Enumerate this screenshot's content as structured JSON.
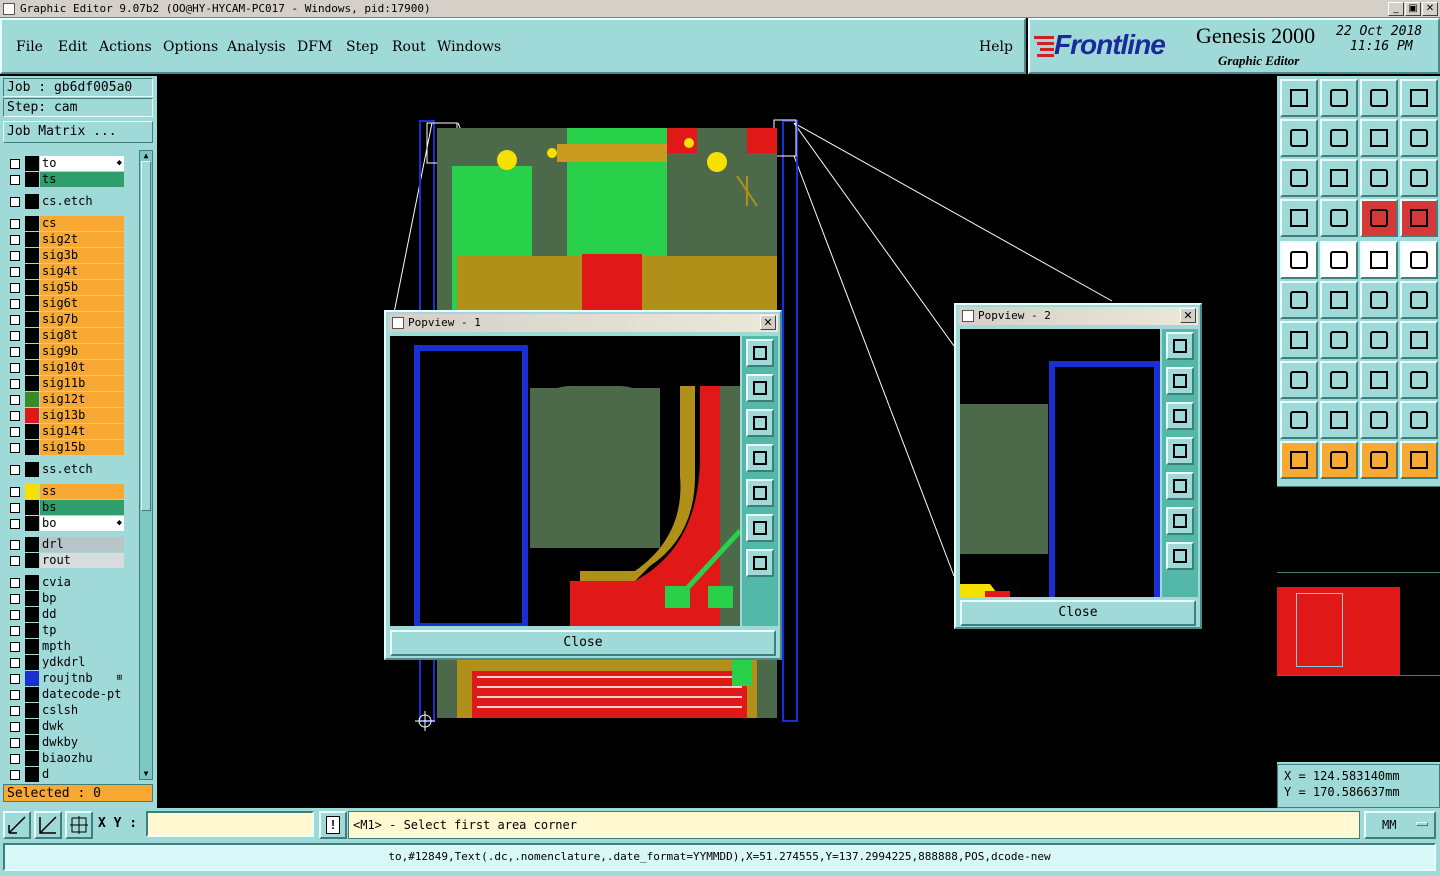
{
  "window": {
    "title": "Graphic Editor 9.07b2 (OO@HY-HYCAM-PC017 - Windows, pid:17900)",
    "min": "_",
    "max": "▣",
    "close": "✕"
  },
  "menu": {
    "items": [
      "File",
      "Edit",
      "Actions",
      "Options",
      "Analysis",
      "DFM",
      "Step",
      "Rout",
      "Windows"
    ],
    "help": "Help"
  },
  "brand": {
    "logo": "Frontline",
    "product": "Genesis 2000",
    "subtitle": "Graphic Editor",
    "date": "22 Oct 2018",
    "time": "11:16 PM"
  },
  "job": {
    "job_label": "Job : gb6df005a0",
    "step_label": "Step: cam",
    "matrix_button": "Job Matrix ..."
  },
  "layers": [
    {
      "name": "to",
      "bg": "#ffffff",
      "swatch": "#000000",
      "mark": "◆"
    },
    {
      "name": "ts",
      "bg": "#2e9e6c",
      "swatch": "#000000"
    },
    {
      "name": "cs.etch",
      "bg": "#9fdad8",
      "swatch": "#000000"
    },
    {
      "name": "cs",
      "bg": "#f7a933",
      "swatch": "#000000"
    },
    {
      "name": "sig2t",
      "bg": "#f7a933",
      "swatch": "#000000"
    },
    {
      "name": "sig3b",
      "bg": "#f7a933",
      "swatch": "#000000"
    },
    {
      "name": "sig4t",
      "bg": "#f7a933",
      "swatch": "#000000"
    },
    {
      "name": "sig5b",
      "bg": "#f7a933",
      "swatch": "#000000"
    },
    {
      "name": "sig6t",
      "bg": "#f7a933",
      "swatch": "#000000"
    },
    {
      "name": "sig7b",
      "bg": "#f7a933",
      "swatch": "#000000"
    },
    {
      "name": "sig8t",
      "bg": "#f7a933",
      "swatch": "#000000"
    },
    {
      "name": "sig9b",
      "bg": "#f7a933",
      "swatch": "#000000"
    },
    {
      "name": "sig10t",
      "bg": "#f7a933",
      "swatch": "#000000"
    },
    {
      "name": "sig11b",
      "bg": "#f7a933",
      "swatch": "#000000"
    },
    {
      "name": "sig12t",
      "bg": "#f7a933",
      "swatch": "#3a8a2a"
    },
    {
      "name": "sig13b",
      "bg": "#f7a933",
      "swatch": "#e01818"
    },
    {
      "name": "sig14t",
      "bg": "#f7a933",
      "swatch": "#000000"
    },
    {
      "name": "sig15b",
      "bg": "#f7a933",
      "swatch": "#000000"
    },
    {
      "name": "ss.etch",
      "bg": "#9fdad8",
      "swatch": "#000000"
    },
    {
      "name": "ss",
      "bg": "#f7a933",
      "swatch": "#f5e000"
    },
    {
      "name": "bs",
      "bg": "#2e9e6c",
      "swatch": "#000000"
    },
    {
      "name": "bo",
      "bg": "#ffffff",
      "swatch": "#000000",
      "mark": "◆"
    },
    {
      "name": "drl",
      "bg": "#b8c4c8",
      "swatch": "#000000"
    },
    {
      "name": "rout",
      "bg": "#d8dcdc",
      "swatch": "#000000"
    },
    {
      "name": "cvia",
      "bg": "#9fdad8",
      "swatch": "#000000"
    },
    {
      "name": "bp",
      "bg": "#9fdad8",
      "swatch": "#000000"
    },
    {
      "name": "dd",
      "bg": "#9fdad8",
      "swatch": "#000000"
    },
    {
      "name": "tp",
      "bg": "#9fdad8",
      "swatch": "#000000"
    },
    {
      "name": "mpth",
      "bg": "#9fdad8",
      "swatch": "#000000"
    },
    {
      "name": "ydkdrl",
      "bg": "#9fdad8",
      "swatch": "#000000"
    },
    {
      "name": "roujtnb",
      "bg": "#9fdad8",
      "swatch": "#1a2fd0",
      "mark": "⊞"
    },
    {
      "name": "datecode-pt",
      "bg": "#9fdad8",
      "swatch": "#000000"
    },
    {
      "name": "cslsh",
      "bg": "#9fdad8",
      "swatch": "#000000"
    },
    {
      "name": "dwk",
      "bg": "#9fdad8",
      "swatch": "#000000"
    },
    {
      "name": "dwkby",
      "bg": "#9fdad8",
      "swatch": "#000000"
    },
    {
      "name": "biaozhu",
      "bg": "#9fdad8",
      "swatch": "#000000"
    },
    {
      "name": "d",
      "bg": "#9fdad8",
      "swatch": "#000000"
    }
  ],
  "selected": "Selected : 0",
  "popview1": {
    "title": "Popview - 1",
    "close": "Close"
  },
  "popview2": {
    "title": "Popview - 2",
    "close": "Close"
  },
  "coords": {
    "x": "X = 124.583140mm",
    "y": "Y = 170.586637mm"
  },
  "bottom": {
    "xy_label": "X Y :",
    "xy_value": "",
    "prompt": "<M1> - Select first area corner",
    "units": "MM",
    "status": "to,#12849,Text(.dc,.nomenclature,.date_format=YYMMDD),X=51.274555,Y=137.2994225,888888,POS,dcode-new"
  }
}
